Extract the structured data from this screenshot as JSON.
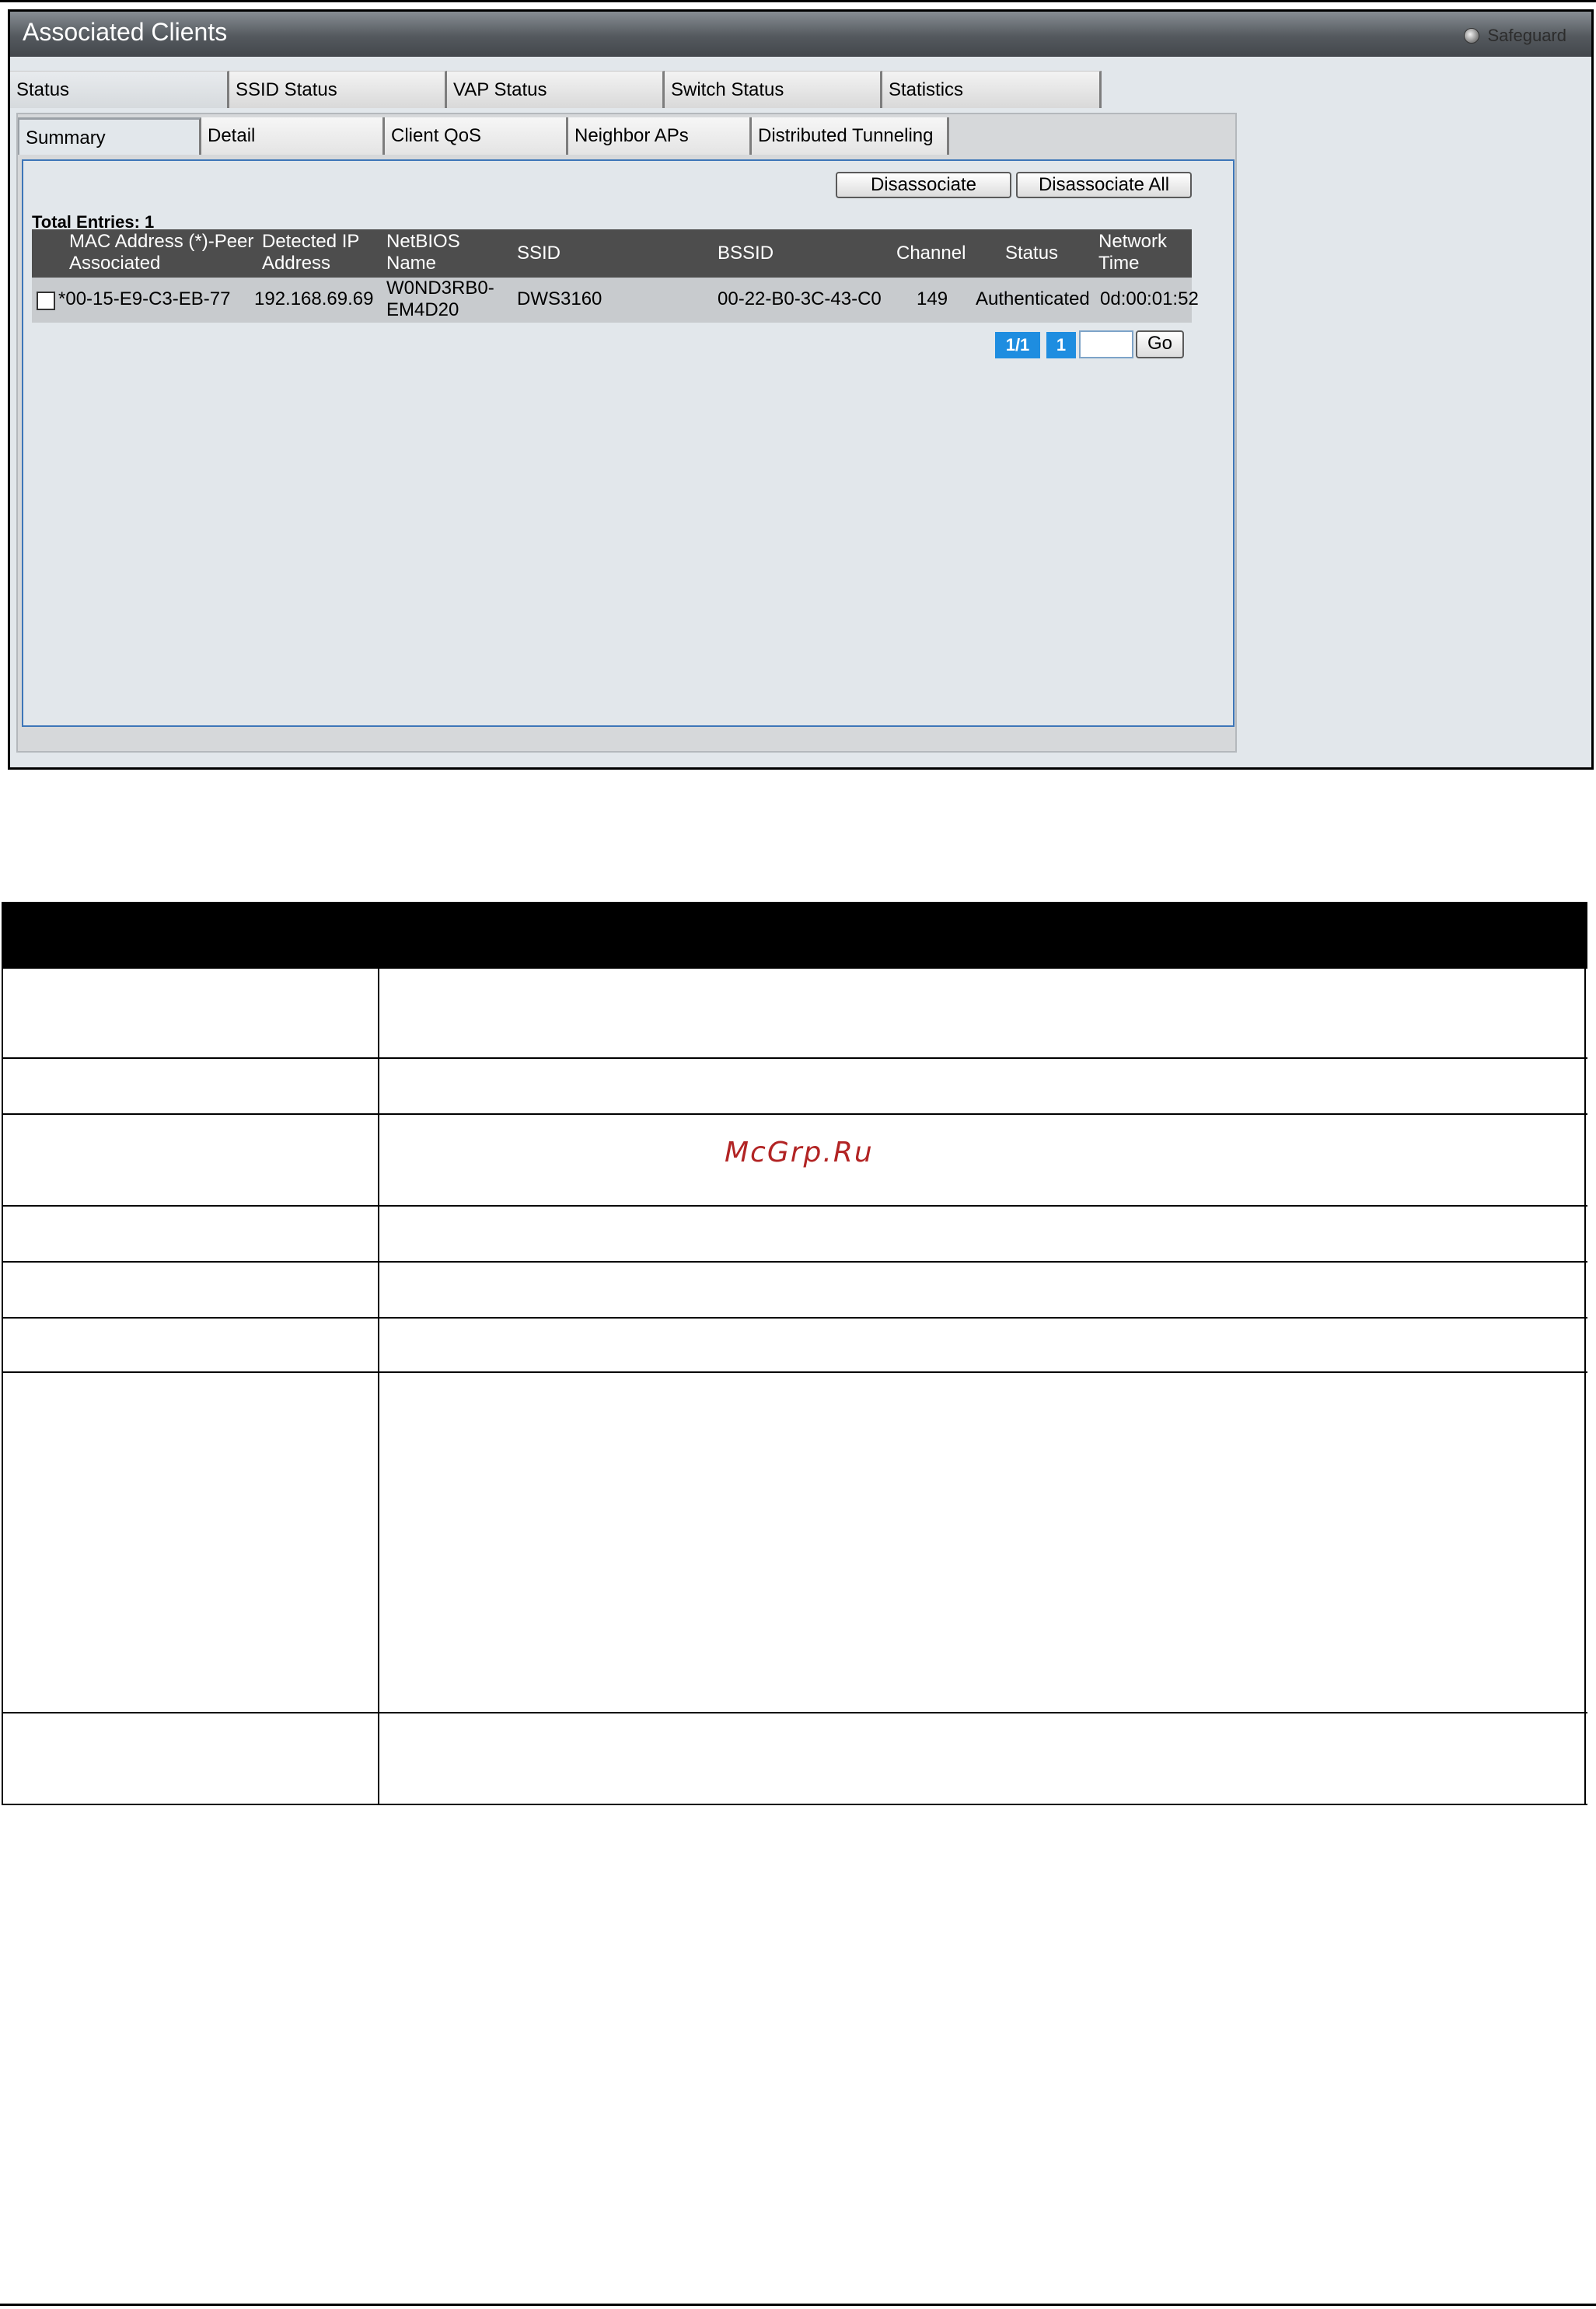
{
  "window": {
    "title": "Associated Clients",
    "safeguard_label": "Safeguard"
  },
  "main_tabs": [
    {
      "label": "Status",
      "active": true
    },
    {
      "label": "SSID Status",
      "active": false
    },
    {
      "label": "VAP Status",
      "active": false
    },
    {
      "label": "Switch Status",
      "active": false
    },
    {
      "label": "Statistics",
      "active": false
    }
  ],
  "sub_tabs": [
    {
      "label": "Summary",
      "active": true
    },
    {
      "label": "Detail",
      "active": false
    },
    {
      "label": "Client QoS",
      "active": false
    },
    {
      "label": "Neighbor APs",
      "active": false
    },
    {
      "label": "Distributed Tunneling",
      "active": false
    }
  ],
  "actions": {
    "disassociate_label": "Disassociate",
    "disassociate_all_label": "Disassociate All"
  },
  "total_entries": "Total Entries: 1",
  "table": {
    "headers": {
      "mac_line1": "MAC Address (*)-Peer",
      "mac_line2": "Associated",
      "ip_line1": "Detected IP",
      "ip_line2": "Address",
      "netbios_line1": "NetBIOS",
      "netbios_line2": "Name",
      "ssid": "SSID",
      "bssid": "BSSID",
      "channel": "Channel",
      "status": "Status",
      "time_line1": "Network",
      "time_line2": "Time"
    },
    "rows": [
      {
        "mac": "*00-15-E9-C3-EB-77",
        "ip": "192.168.69.69",
        "netbios_line1": "W0ND3RB0-",
        "netbios_line2": "EM4D20",
        "ssid": "DWS3160",
        "bssid": "00-22-B0-3C-43-C0",
        "channel": "149",
        "status": "Authenticated",
        "time": "0d:00:01:52"
      }
    ]
  },
  "pagination": {
    "page_of": "1/1",
    "current": "1",
    "go_label": "Go"
  },
  "watermark": "McGrp.Ru",
  "colors": {
    "title_bar": "#54595e",
    "panel_border": "#3d76b8",
    "page_badge": "#1e8de0",
    "watermark": "#b22424"
  }
}
